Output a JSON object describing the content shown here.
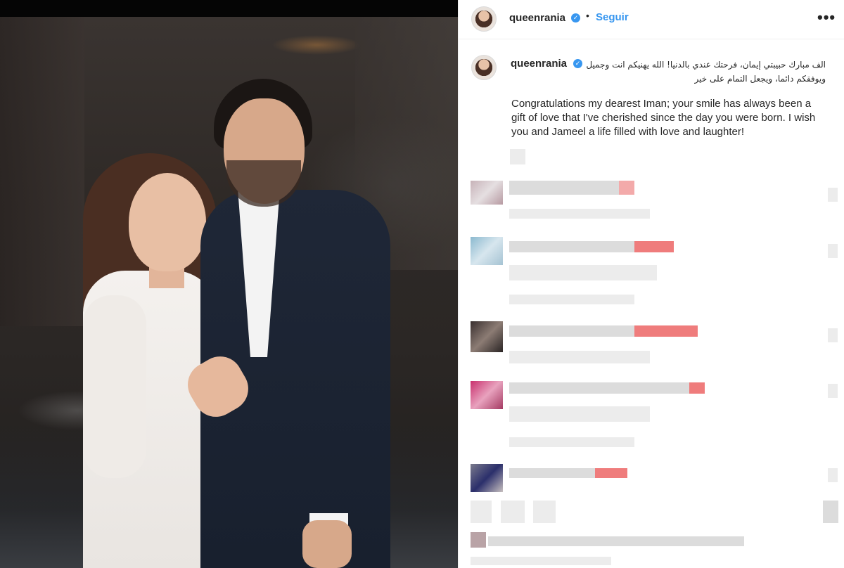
{
  "post": {
    "username": "queenrania",
    "follow_label": "Seguir",
    "more_label": "•••",
    "separator": "•",
    "verified_mark": "✓"
  },
  "caption": {
    "username": "queenrania",
    "arabic_text": "الف مبارك حبيبتي إيمان، فرحتك عندي بالدنيا! الله يهنيكم انت وجميل ويوفقكم دائما، ويجعل التمام على خير",
    "english_text": "Congratulations my dearest Iman; your smile has always been a gift of love that I've cherished since the day you were born. I wish you and Jameel a life filled with love and laughter!"
  },
  "icons": {
    "verified": "verified-badge-icon",
    "more": "more-options-icon"
  },
  "colors": {
    "link_blue": "#3897f0",
    "text": "#262626",
    "divider": "#efefef"
  }
}
